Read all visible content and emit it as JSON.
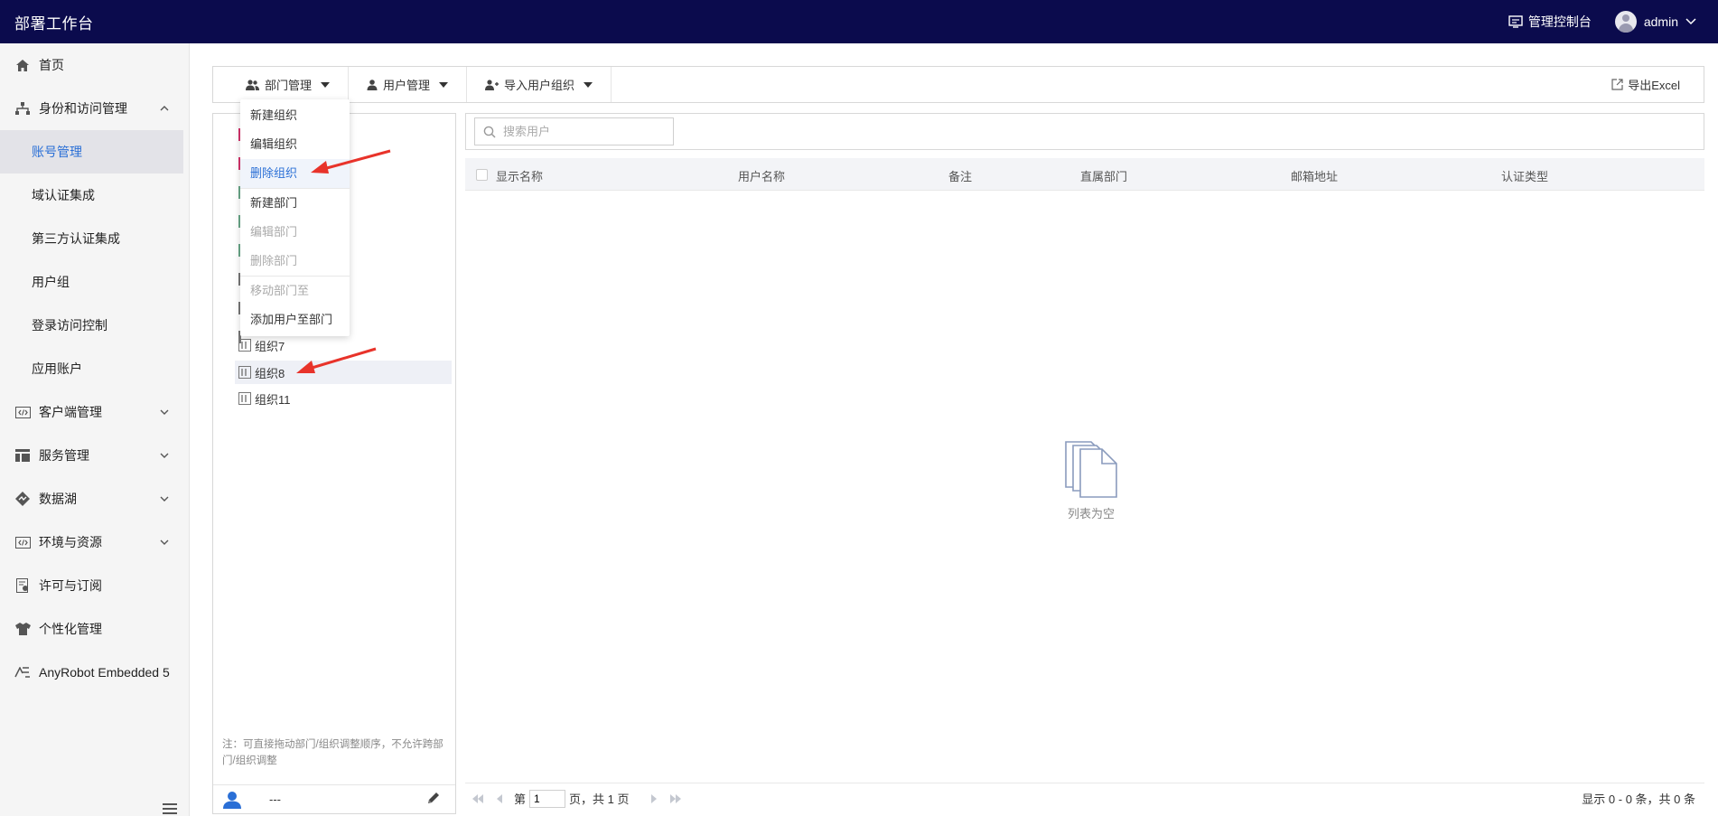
{
  "header": {
    "app_title": "部署工作台",
    "console_label": "管理控制台",
    "user_name": "admin"
  },
  "sidebar": {
    "items": [
      {
        "label": "首页",
        "icon": "home-icon"
      },
      {
        "label": "身份和访问管理",
        "icon": "org-chart-icon"
      },
      {
        "label": "账号管理"
      },
      {
        "label": "域认证集成"
      },
      {
        "label": "第三方认证集成"
      },
      {
        "label": "用户组"
      },
      {
        "label": "登录访问控制"
      },
      {
        "label": "应用账户"
      },
      {
        "label": "客户端管理",
        "icon": "code-icon"
      },
      {
        "label": "服务管理",
        "icon": "grid-icon"
      },
      {
        "label": "数据湖",
        "icon": "datalake-icon"
      },
      {
        "label": "环境与资源",
        "icon": "code-icon"
      },
      {
        "label": "许可与订阅",
        "icon": "license-icon"
      },
      {
        "label": "个性化管理",
        "icon": "shirt-icon"
      },
      {
        "label": "AnyRobot Embedded 5",
        "icon": "anyrobot-icon"
      }
    ]
  },
  "toolbar": {
    "dept_mgmt": "部门管理",
    "user_mgmt": "用户管理",
    "import_group": "导入用户组织",
    "export": "导出Excel"
  },
  "dropdown": {
    "items": [
      "新建组织",
      "编辑组织",
      "删除组织",
      "新建部门",
      "编辑部门",
      "删除部门",
      "移动部门至",
      "添加用户至部门"
    ]
  },
  "tree": {
    "items": [
      "组织7",
      "组织8",
      "组织11"
    ],
    "note": "注：可直接拖动部门/组织调整顺序，不允许跨部门/组织调整",
    "footer_value": "---"
  },
  "search": {
    "placeholder": "搜索用户"
  },
  "table": {
    "columns": [
      "显示名称",
      "用户名称",
      "备注",
      "直属部门",
      "邮箱地址",
      "认证类型"
    ],
    "empty_text": "列表为空"
  },
  "pager": {
    "prefix": "第",
    "page": "1",
    "suffix": "页，共 1 页",
    "summary": "显示 0 - 0 条，共 0 条"
  },
  "colors": {
    "topbar": "#0b0b4d",
    "accent": "#2a6fd6",
    "arrow": "#e8332a"
  }
}
